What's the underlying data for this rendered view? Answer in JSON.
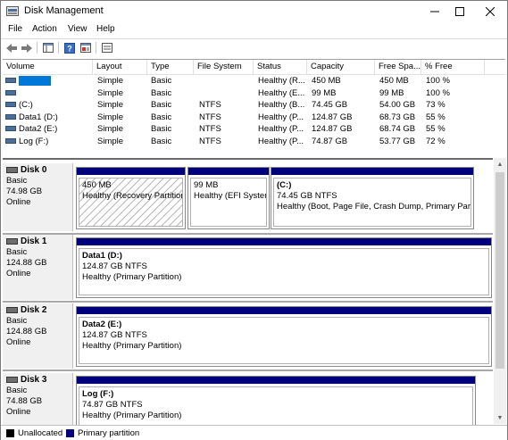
{
  "window": {
    "title": "Disk Management"
  },
  "menu": [
    "File",
    "Action",
    "View",
    "Help"
  ],
  "columns": [
    "Volume",
    "Layout",
    "Type",
    "File System",
    "Status",
    "Capacity",
    "Free Spa...",
    "% Free"
  ],
  "volumes": [
    {
      "name": "",
      "layout": "Simple",
      "type": "Basic",
      "fs": "",
      "status": "Healthy (R...",
      "capacity": "450 MB",
      "free": "450 MB",
      "pct": "100 %"
    },
    {
      "name": "",
      "layout": "Simple",
      "type": "Basic",
      "fs": "",
      "status": "Healthy (E...",
      "capacity": "99 MB",
      "free": "99 MB",
      "pct": "100 %"
    },
    {
      "name": "(C:)",
      "layout": "Simple",
      "type": "Basic",
      "fs": "NTFS",
      "status": "Healthy (B...",
      "capacity": "74.45 GB",
      "free": "54.00 GB",
      "pct": "73 %"
    },
    {
      "name": "Data1 (D:)",
      "layout": "Simple",
      "type": "Basic",
      "fs": "NTFS",
      "status": "Healthy (P...",
      "capacity": "124.87 GB",
      "free": "68.73 GB",
      "pct": "55 %"
    },
    {
      "name": "Data2 (E:)",
      "layout": "Simple",
      "type": "Basic",
      "fs": "NTFS",
      "status": "Healthy (P...",
      "capacity": "124.87 GB",
      "free": "68.74 GB",
      "pct": "55 %"
    },
    {
      "name": "Log (F:)",
      "layout": "Simple",
      "type": "Basic",
      "fs": "NTFS",
      "status": "Healthy (P...",
      "capacity": "74.87 GB",
      "free": "53.77 GB",
      "pct": "72 %"
    }
  ],
  "disks": [
    {
      "name": "Disk 0",
      "type": "Basic",
      "size": "74.98 GB",
      "state": "Online",
      "partitions": [
        {
          "label": "",
          "size": "450 MB",
          "status": "Healthy (Recovery Partition"
        },
        {
          "label": "",
          "size": "99 MB",
          "status": "Healthy (EFI System"
        },
        {
          "label": "(C:)",
          "size": "74.45 GB NTFS",
          "status": "Healthy (Boot, Page File, Crash Dump, Primary Partit"
        }
      ]
    },
    {
      "name": "Disk 1",
      "type": "Basic",
      "size": "124.88 GB",
      "state": "Online",
      "partitions": [
        {
          "label": "Data1  (D:)",
          "size": "124.87 GB NTFS",
          "status": "Healthy (Primary Partition)"
        }
      ]
    },
    {
      "name": "Disk 2",
      "type": "Basic",
      "size": "124.88 GB",
      "state": "Online",
      "partitions": [
        {
          "label": "Data2  (E:)",
          "size": "124.87 GB NTFS",
          "status": "Healthy (Primary Partition)"
        }
      ]
    },
    {
      "name": "Disk 3",
      "type": "Basic",
      "size": "74.88 GB",
      "state": "Online",
      "partitions": [
        {
          "label": "Log  (F:)",
          "size": "74.87 GB NTFS",
          "status": "Healthy (Primary Partition)"
        }
      ]
    }
  ],
  "legend": {
    "unallocated": "Unallocated",
    "primary": "Primary partition",
    "unallocated_color": "#000000",
    "primary_color": "#00007d"
  },
  "icons": [
    "disk-management-icon",
    "minimize-icon",
    "maximize-icon",
    "close-icon",
    "back-arrow-icon",
    "forward-arrow-icon",
    "console-tree-icon",
    "help-icon",
    "properties-icon",
    "view-icon"
  ]
}
